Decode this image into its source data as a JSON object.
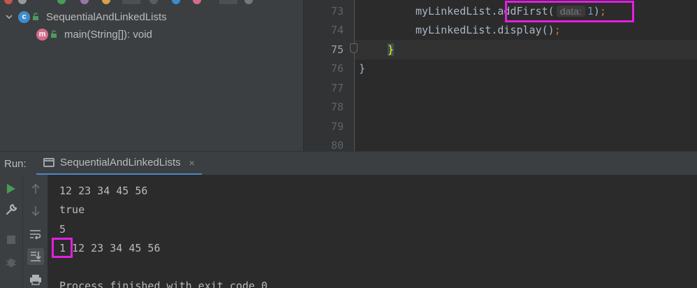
{
  "structure": {
    "class_name": "SequentialAndLinkedLists",
    "class_icon_letter": "c",
    "method_signature": "main(String[]): void",
    "method_icon_letter": "m"
  },
  "editor": {
    "line_numbers": [
      "73",
      "74",
      "75",
      "76",
      "77",
      "78",
      "79",
      "80"
    ],
    "current_line": "75",
    "line73": {
      "receiver": "myLinkedList.",
      "method": "addFirst(",
      "hint": "data:",
      "arg": "1",
      "close": ")",
      "semi": ";"
    },
    "line74": {
      "code": "myLinkedList.display()",
      "semi": ";"
    },
    "line75": {
      "code": "}"
    },
    "line76": {
      "code": "}"
    }
  },
  "run": {
    "label": "Run:",
    "tab_title": "SequentialAndLinkedLists",
    "close_glyph": "×"
  },
  "console": {
    "lines": [
      "12 23 34 45 56",
      "true",
      "5",
      "1 12 23 34 45 56",
      "Process finished with exit code 0"
    ]
  },
  "colors": {
    "highlight_box": "#e020e0",
    "keyword": "#cc7832",
    "number": "#6897bb",
    "run_green": "#499c54"
  }
}
